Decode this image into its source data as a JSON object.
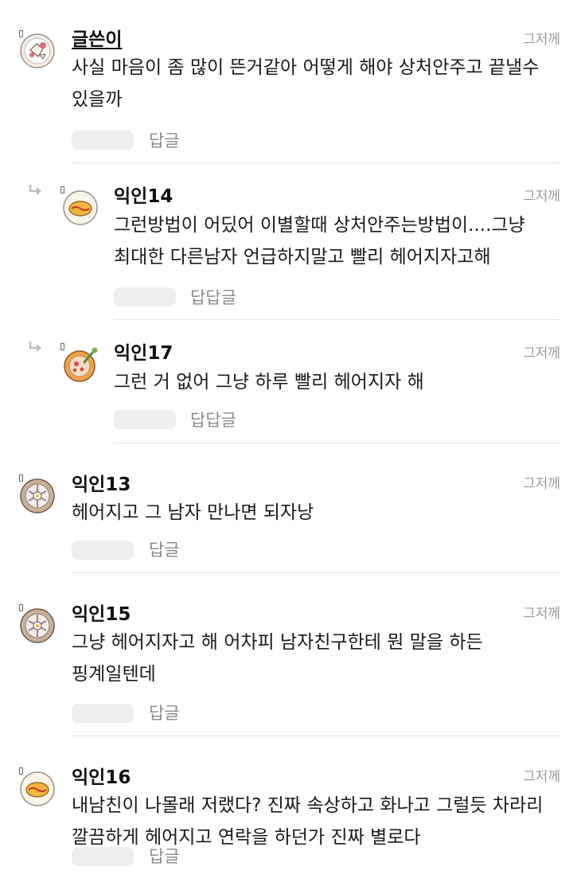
{
  "comments": [
    {
      "author": "글쓴이",
      "time": "그저께",
      "text": "사실 마음이 좀 많이 뜬거같아 어떻게 해야 상처안주고 끝낼수 있을까",
      "reply_label": "답글"
    },
    {
      "author": "익인14",
      "time": "그저께",
      "text": "그런방법이 어딨어 이별할때 상처안주는방법이....그냥 최대한 다른남자 언급하지말고 빨리 헤어지자고해",
      "reply_label": "답답글"
    },
    {
      "author": "익인17",
      "time": "그저께",
      "text": "그런 거 없어 그냥 하루 빨리 헤어지자 해",
      "reply_label": "답답글"
    },
    {
      "author": "익인13",
      "time": "그저께",
      "text": "헤어지고 그 남자 만나면 되자낭",
      "reply_label": "답글"
    },
    {
      "author": "익인15",
      "time": "그저께",
      "text": "그냥 헤어지자고 해 어차피 남자친구한테 뭔 말을 하든 핑계일텐데",
      "reply_label": "답글"
    },
    {
      "author": "익인16",
      "time": "그저께",
      "text": "내남친이 나몰래 저랬다? 진짜 속상하고 화나고 그럴듯 차라리 깔끔하게 헤어지고 연락을 하던가 진짜 별로다",
      "reply_label": "답글"
    }
  ],
  "avatar_icons": [
    "salad-bowl-icon",
    "omelette-icon",
    "soup-bowl-icon",
    "bibimbap-icon",
    "bibimbap-icon",
    "omelette-icon"
  ]
}
